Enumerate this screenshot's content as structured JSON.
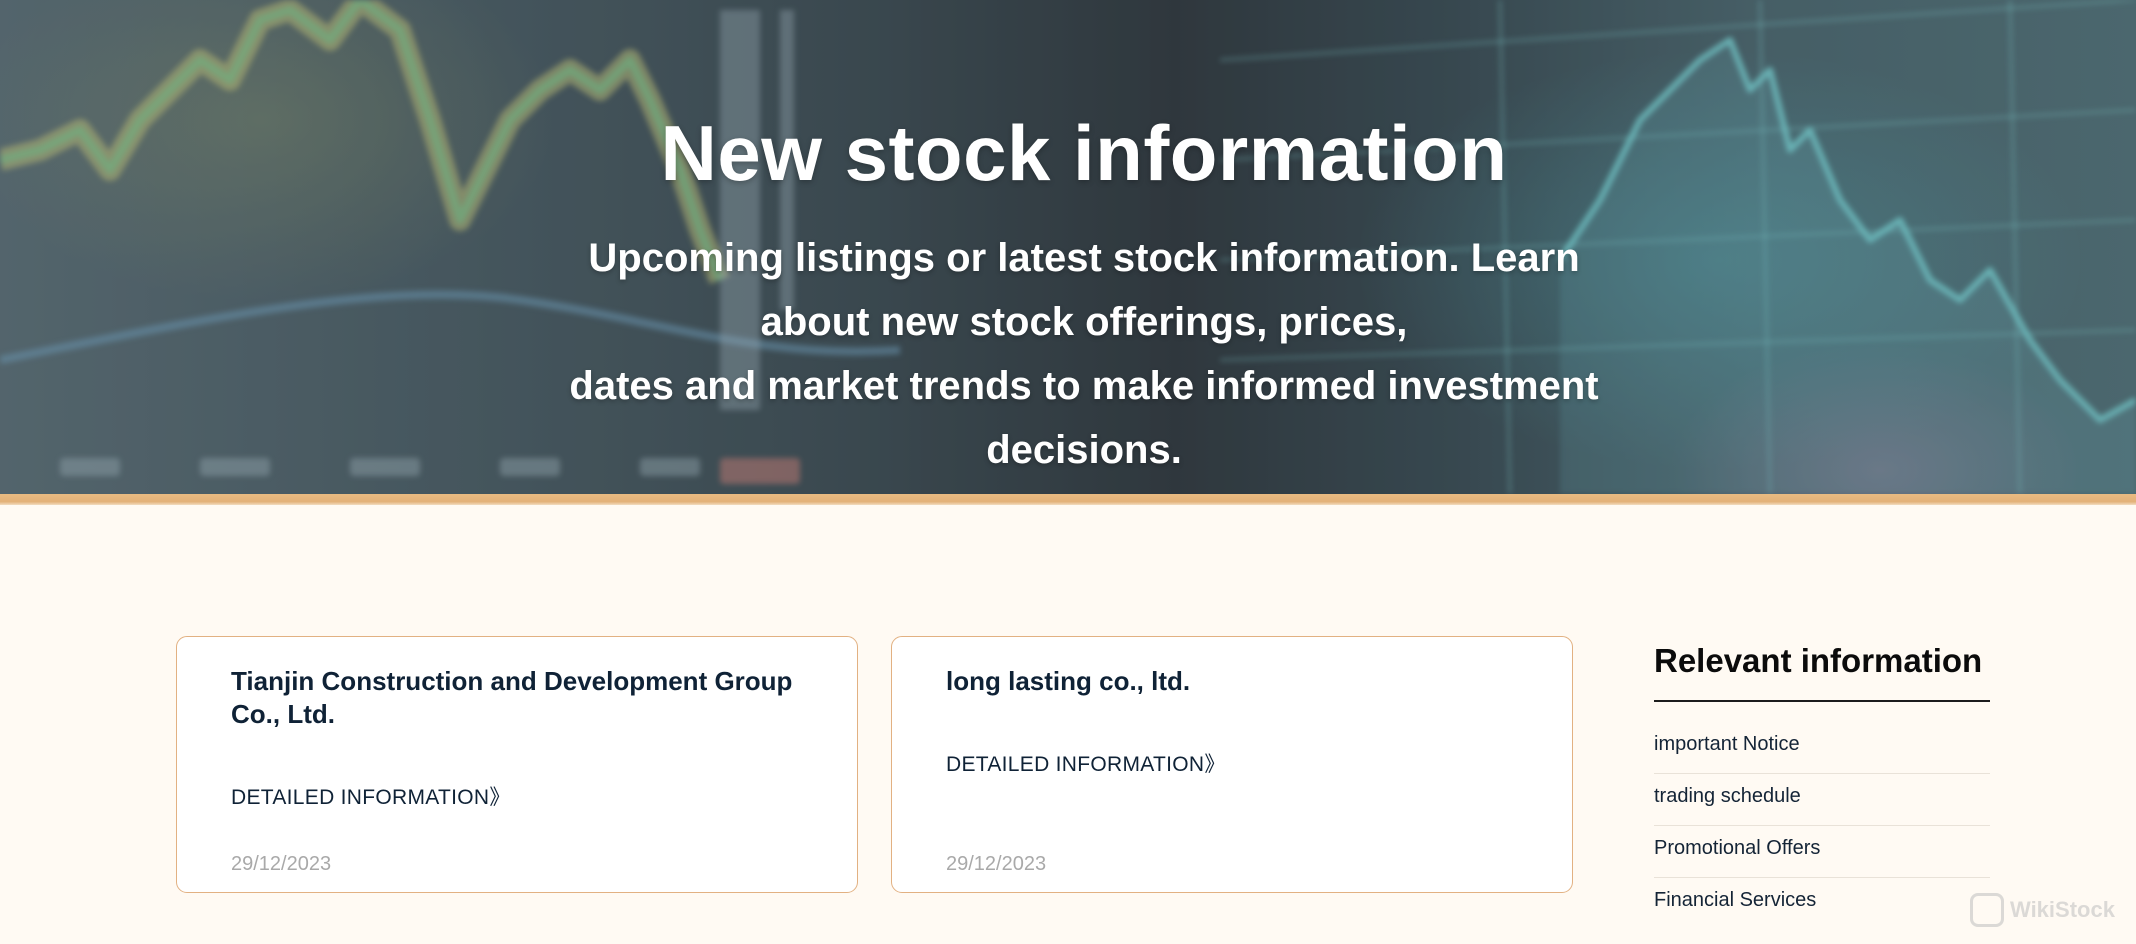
{
  "hero": {
    "title": "New stock information",
    "subtitle_lines": [
      "Upcoming listings or latest stock information. Learn",
      "about new stock offerings, prices,",
      "dates and market trends to make informed investment",
      "decisions."
    ]
  },
  "cards": [
    {
      "title": "Tianjin Construction and Development Group Co., Ltd.",
      "link_label": "DETAILED INFORMATION》",
      "date": "29/12/2023"
    },
    {
      "title": "long lasting co., ltd.",
      "link_label": "DETAILED INFORMATION》",
      "date": "29/12/2023"
    }
  ],
  "sidebar": {
    "title": "Relevant information",
    "items": [
      "important Notice",
      "trading schedule",
      "Promotional Offers",
      "Financial Services"
    ]
  },
  "watermark": {
    "text": "WikiStock"
  },
  "colors": {
    "accent_bar": "#e3b178",
    "card_border": "#e2b182",
    "page_background": "#fffaf3",
    "text_dark": "#0f2236",
    "date_gray": "#a9a9a9"
  }
}
